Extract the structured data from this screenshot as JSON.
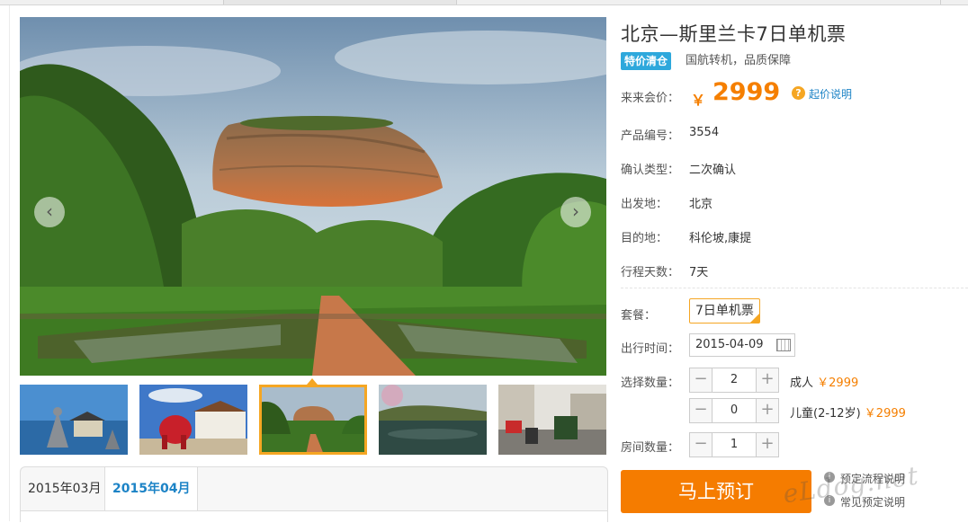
{
  "product": {
    "title": "北京—斯里兰卡7日单机票",
    "badge": "特价清仓",
    "subtitle": "国航转机，品质保障",
    "price_label": "来来会价：",
    "price_currency": "￥",
    "price_value": "2999",
    "price_help": "起价说明",
    "price_help_icon": "?"
  },
  "details": [
    {
      "label": "产品编号：",
      "value": "3554"
    },
    {
      "label": "确认类型：",
      "value": "二次确认"
    },
    {
      "label": "出发地：",
      "value": "北京"
    },
    {
      "label": "目的地：",
      "value": "科伦坡,康提"
    },
    {
      "label": "行程天数：",
      "value": "7天"
    }
  ],
  "booking": {
    "package_label": "套餐：",
    "package_value": "7日单机票",
    "date_label": "出行时间：",
    "date_value": "2015-04-09",
    "quantity_label": "选择数量：",
    "adult_qty": "2",
    "adult_label": "成人",
    "adult_price": "￥2999",
    "child_qty": "0",
    "child_label": "儿童(2-12岁)",
    "child_price": "￥2999",
    "room_label": "房间数量：",
    "room_qty": "1",
    "minus": "−",
    "plus": "+",
    "book_button": "马上预订",
    "help_links": [
      "预定流程说明",
      "常见预定说明"
    ],
    "help_icon_char": "i"
  },
  "gallery": {
    "prev": "‹",
    "next": "›",
    "thumbnails": [
      "buddha-statue",
      "temple-elephant",
      "sigiriya-rock",
      "lake-view",
      "street-tuktuk"
    ],
    "selected_index": 2
  },
  "calendar_tabs": [
    "2015年03月",
    "2015年04月"
  ],
  "watermark": "eLdog.net",
  "colors": {
    "accent_orange": "#f57c00",
    "badge_blue": "#2ea8dc",
    "link_blue": "#1c83c6",
    "thumb_highlight": "#f5a623"
  }
}
